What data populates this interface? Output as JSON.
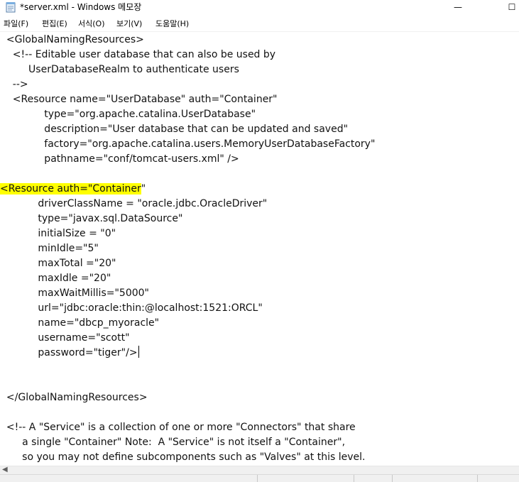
{
  "window": {
    "title": "*server.xml - Windows 메모장",
    "minimize_glyph": "—",
    "maximize_glyph": "☐"
  },
  "menu": [
    {
      "label": "파일(F)"
    },
    {
      "label": "편집(E)"
    },
    {
      "label": "서식(O)"
    },
    {
      "label": "보기(V)"
    },
    {
      "label": "도움말(H)"
    }
  ],
  "editor": {
    "lines": [
      {
        "text": "  <GlobalNamingResources>"
      },
      {
        "text": "    <!-- Editable user database that can also be used by"
      },
      {
        "text": "         UserDatabaseRealm to authenticate users"
      },
      {
        "text": "    -->"
      },
      {
        "text": "    <Resource name=\"UserDatabase\" auth=\"Container\""
      },
      {
        "text": "              type=\"org.apache.catalina.UserDatabase\""
      },
      {
        "text": "              description=\"User database that can be updated and saved\""
      },
      {
        "text": "              factory=\"org.apache.catalina.users.MemoryUserDatabaseFactory\""
      },
      {
        "text": "              pathname=\"conf/tomcat-users.xml\" />"
      },
      {
        "text": ""
      },
      {
        "highlight": "<Resource auth=\"Container",
        "rest": "\""
      },
      {
        "text": "            driverClassName = \"oracle.jdbc.OracleDriver\""
      },
      {
        "text": "            type=\"javax.sql.DataSource\""
      },
      {
        "text": "            initialSize = \"0\""
      },
      {
        "text": "            minIdle=\"5\""
      },
      {
        "text": "            maxTotal =\"20\""
      },
      {
        "text": "            maxIdle =\"20\""
      },
      {
        "text": "            maxWaitMillis=\"5000\""
      },
      {
        "text": "            url=\"jdbc:oracle:thin:@localhost:1521:ORCL\""
      },
      {
        "text": "            name=\"dbcp_myoracle\""
      },
      {
        "text": "            username=\"scott\""
      },
      {
        "text": "            password=\"tiger\"/>",
        "caret": true
      },
      {
        "text": ""
      },
      {
        "text": ""
      },
      {
        "text": "  </GlobalNamingResources>"
      },
      {
        "text": ""
      },
      {
        "text": "  <!-- A \"Service\" is a collection of one or more \"Connectors\" that share"
      },
      {
        "text": "       a single \"Container\" Note:  A \"Service\" is not itself a \"Container\","
      },
      {
        "text": "       so you may not define subcomponents such as \"Valves\" at this level."
      }
    ]
  },
  "scrollbar": {
    "left_arrow": "◀"
  }
}
